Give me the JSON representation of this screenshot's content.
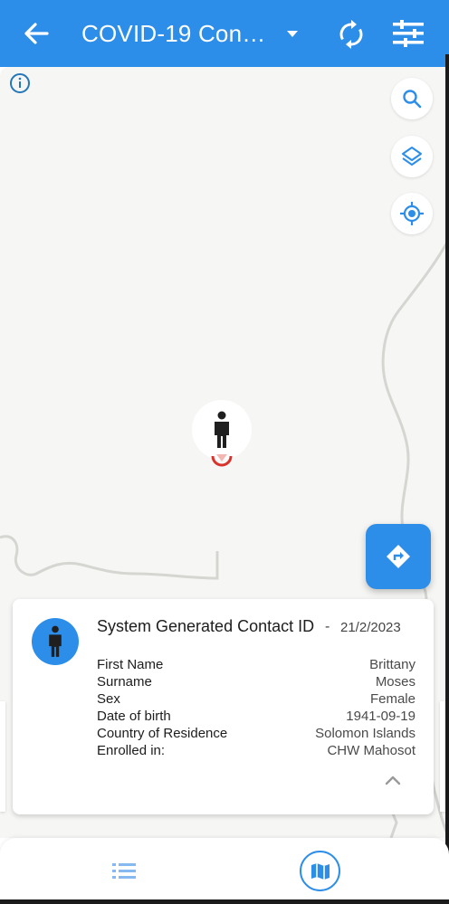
{
  "app_bar": {
    "title": "COVID-19 Conta…",
    "back_icon": "arrow-left-icon",
    "dropdown_icon": "caret-down-icon",
    "sync_icon": "sync-icon",
    "filter_icon": "sliders-icon",
    "background": "#2D8EEA"
  },
  "map_controls": {
    "info_icon": "info-icon",
    "search_icon": "search-icon",
    "layers_icon": "layers-icon",
    "locate_icon": "my-location-icon",
    "directions_icon": "directions-icon"
  },
  "marker": {
    "icon": "person-icon"
  },
  "card": {
    "title": "System Generated Contact ID",
    "separator": "-",
    "date": "21/2/2023",
    "attributes": [
      {
        "label": "First Name",
        "value": "Brittany"
      },
      {
        "label": "Surname",
        "value": "Moses"
      },
      {
        "label": "Sex",
        "value": "Female"
      },
      {
        "label": "Date of birth",
        "value": "1941-09-19"
      },
      {
        "label": "Country of Residence",
        "value": "Solomon Islands"
      },
      {
        "label": "Enrolled in:",
        "value": "CHW Mahosot"
      }
    ]
  },
  "bottom_nav": {
    "list_icon": "list-icon",
    "map_icon": "map-icon"
  },
  "colors": {
    "accent": "#2D8EEA",
    "marker_ring": "#D9322B",
    "map_bg": "#F6F6F4"
  }
}
